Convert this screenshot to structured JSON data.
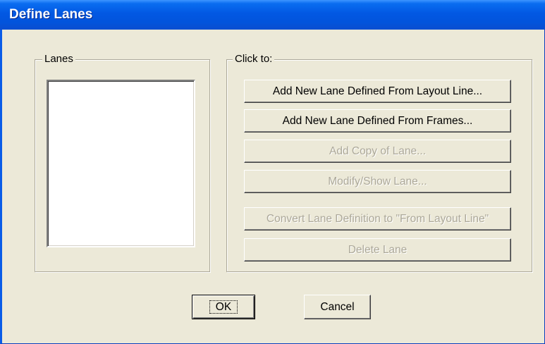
{
  "window": {
    "title": "Define Lanes"
  },
  "lanes_group": {
    "label": "Lanes",
    "items": []
  },
  "actions_group": {
    "label": "Click to:",
    "buttons": [
      {
        "label": "Add New Lane Defined From Layout Line...",
        "enabled": true
      },
      {
        "label": "Add New Lane Defined From Frames...",
        "enabled": true
      },
      {
        "label": "Add Copy of Lane...",
        "enabled": false
      },
      {
        "label": "Modify/Show Lane...",
        "enabled": false
      },
      {
        "label": "Convert Lane Definition to \"From Layout Line\"",
        "enabled": false
      },
      {
        "label": "Delete Lane",
        "enabled": false
      }
    ]
  },
  "footer": {
    "ok_label": "OK",
    "cancel_label": "Cancel"
  },
  "colors": {
    "titlebar": "#0254dc",
    "dialog_face": "#ece9d8",
    "disabled_text": "#aca899"
  }
}
